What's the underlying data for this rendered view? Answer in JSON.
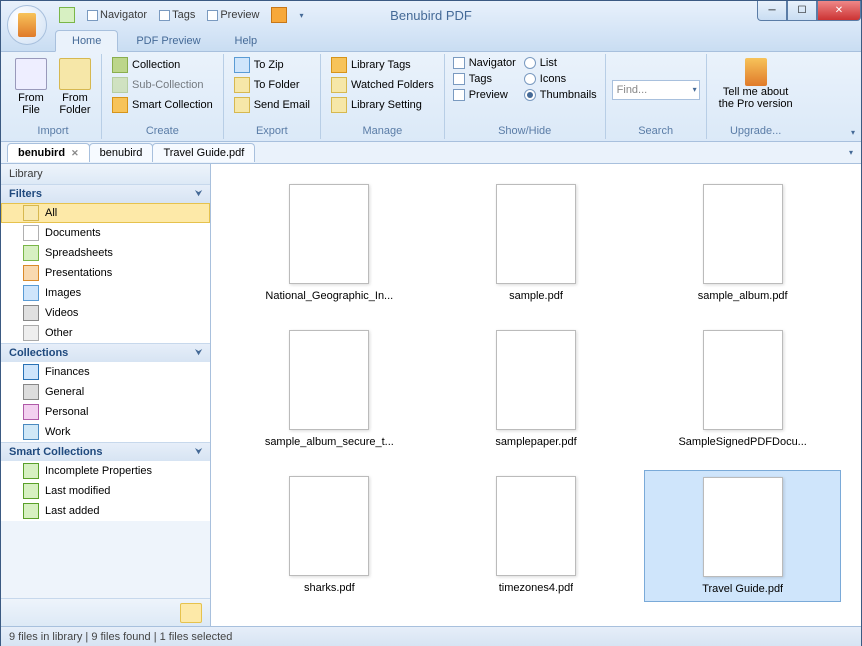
{
  "app": {
    "title": "Benubird PDF"
  },
  "qat": {
    "navigator": "Navigator",
    "tags": "Tags",
    "preview": "Preview"
  },
  "ribbon_tabs": {
    "home": "Home",
    "pdf_preview": "PDF Preview",
    "help": "Help"
  },
  "ribbon": {
    "import": {
      "label": "Import",
      "from_file": "From\nFile",
      "from_folder": "From\nFolder"
    },
    "create": {
      "label": "Create",
      "collection": "Collection",
      "sub_collection": "Sub-Collection",
      "smart_collection": "Smart Collection"
    },
    "export": {
      "label": "Export",
      "to_zip": "To Zip",
      "to_folder": "To Folder",
      "send_email": "Send Email"
    },
    "manage": {
      "label": "Manage",
      "library_tags": "Library Tags",
      "watched_folders": "Watched Folders",
      "library_setting": "Library Setting"
    },
    "showhide": {
      "label": "Show/Hide",
      "navigator": "Navigator",
      "tags": "Tags",
      "preview": "Preview",
      "list": "List",
      "icons": "Icons",
      "thumbnails": "Thumbnails"
    },
    "search": {
      "label": "Search",
      "placeholder": "Find..."
    },
    "upgrade": {
      "label": "Upgrade...",
      "line1": "Tell me about",
      "line2": "the Pro version"
    }
  },
  "doctabs": [
    {
      "label": "benubird",
      "active": true,
      "closable": true
    },
    {
      "label": "benubird",
      "active": false,
      "closable": false
    },
    {
      "label": "Travel Guide.pdf",
      "active": false,
      "closable": false
    }
  ],
  "sidebar": {
    "library": "Library",
    "filters": {
      "label": "Filters",
      "items": [
        {
          "key": "all",
          "label": "All"
        },
        {
          "key": "documents",
          "label": "Documents"
        },
        {
          "key": "spreadsheets",
          "label": "Spreadsheets"
        },
        {
          "key": "presentations",
          "label": "Presentations"
        },
        {
          "key": "images",
          "label": "Images"
        },
        {
          "key": "videos",
          "label": "Videos"
        },
        {
          "key": "other",
          "label": "Other"
        }
      ]
    },
    "collections": {
      "label": "Collections",
      "items": [
        {
          "key": "finances",
          "label": "Finances"
        },
        {
          "key": "general",
          "label": "General"
        },
        {
          "key": "personal",
          "label": "Personal"
        },
        {
          "key": "work",
          "label": "Work"
        }
      ]
    },
    "smart": {
      "label": "Smart Collections",
      "items": [
        {
          "key": "incomplete",
          "label": "Incomplete Properties"
        },
        {
          "key": "lastmod",
          "label": "Last modified"
        },
        {
          "key": "lastadd",
          "label": "Last added"
        }
      ]
    }
  },
  "files": [
    {
      "name": "National_Geographic_In..."
    },
    {
      "name": "sample.pdf"
    },
    {
      "name": "sample_album.pdf"
    },
    {
      "name": "sample_album_secure_t..."
    },
    {
      "name": "samplepaper.pdf"
    },
    {
      "name": "SampleSignedPDFDocu..."
    },
    {
      "name": "sharks.pdf"
    },
    {
      "name": "timezones4.pdf"
    },
    {
      "name": "Travel Guide.pdf",
      "selected": true
    }
  ],
  "status": "9 files in library | 9 files found | 1 files selected"
}
